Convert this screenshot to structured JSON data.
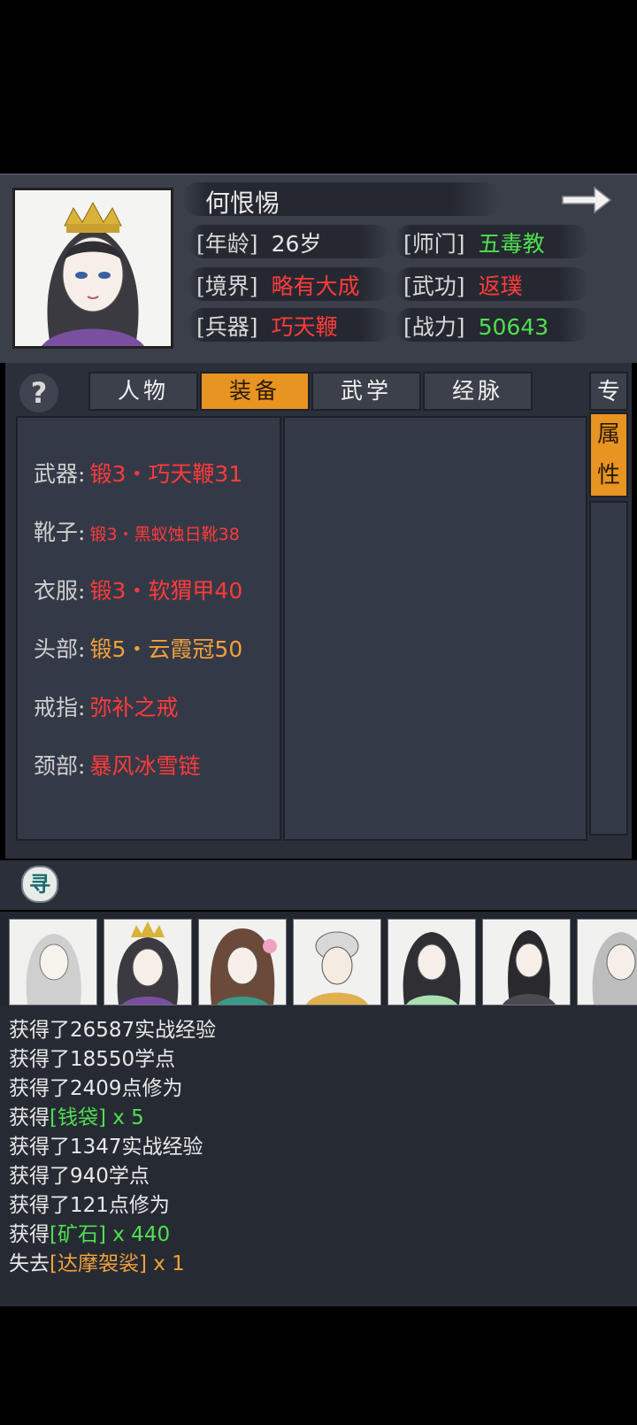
{
  "character": {
    "name": "何恨惕",
    "stats": [
      {
        "label": "[年龄]",
        "value": "26岁",
        "color": "white"
      },
      {
        "label": "[师门]",
        "value": "五毒教",
        "color": "green"
      },
      {
        "label": "[境界]",
        "value": "略有大成",
        "color": "red"
      },
      {
        "label": "[武功]",
        "value": "返璞",
        "color": "red"
      },
      {
        "label": "[兵器]",
        "value": "巧天鞭",
        "color": "red"
      },
      {
        "label": "[战力]",
        "value": "50643",
        "color": "green"
      }
    ]
  },
  "tabs": [
    {
      "label": "人物",
      "active": false
    },
    {
      "label": "装备",
      "active": true
    },
    {
      "label": "武学",
      "active": false
    },
    {
      "label": "经脉",
      "active": false
    }
  ],
  "side_tabs": {
    "top": "专",
    "active_chars": [
      "属",
      "性"
    ]
  },
  "help_label": "?",
  "equipment": [
    {
      "slot": "武器:",
      "item": "锻3・巧天鞭31",
      "color": "red"
    },
    {
      "slot": "靴子:",
      "item": "锻3・黑蚁蚀日靴38",
      "color": "red"
    },
    {
      "slot": "衣服:",
      "item": "锻3・软猬甲40",
      "color": "red"
    },
    {
      "slot": "头部:",
      "item": "锻5・云霞冠50",
      "color": "orange"
    },
    {
      "slot": "戒指:",
      "item": "弥补之戒",
      "color": "red"
    },
    {
      "slot": "颈部:",
      "item": "暴风冰雪链",
      "color": "red"
    }
  ],
  "search_icon_label": "寻",
  "log": [
    {
      "prefix": "获得了26587实战经验",
      "item": "",
      "suffix": "",
      "item_color": ""
    },
    {
      "prefix": "获得了18550学点",
      "item": "",
      "suffix": "",
      "item_color": ""
    },
    {
      "prefix": "获得了2409点修为",
      "item": "",
      "suffix": "",
      "item_color": ""
    },
    {
      "prefix": "获得",
      "item": "[钱袋]",
      "suffix": " x 5",
      "item_color": "green"
    },
    {
      "prefix": "获得了1347实战经验",
      "item": "",
      "suffix": "",
      "item_color": ""
    },
    {
      "prefix": "获得了940学点",
      "item": "",
      "suffix": "",
      "item_color": ""
    },
    {
      "prefix": "获得了121点修为",
      "item": "",
      "suffix": "",
      "item_color": ""
    },
    {
      "prefix": "获得",
      "item": "[矿石]",
      "suffix": " x 440",
      "item_color": "green"
    },
    {
      "prefix": "失去",
      "item": "[达摩袈裟]",
      "suffix": " x 1",
      "item_color": "orange"
    }
  ],
  "colors": {
    "green": "#4fe04f",
    "red": "#ff3a3a",
    "orange": "#f0a23a",
    "accent_tab": "#e79422",
    "panel": "#343947"
  },
  "icons": {
    "next": "arrow-right-icon",
    "help": "help-icon",
    "search": "search-icon"
  }
}
